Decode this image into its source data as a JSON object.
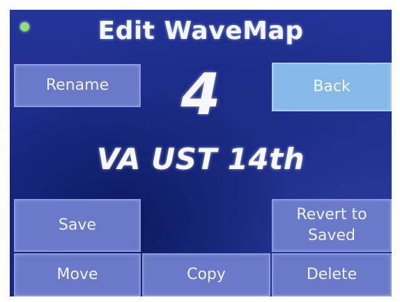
{
  "header": {
    "title": "Edit WaveMap",
    "status_indicator_color": "#8fe07a"
  },
  "wavemap": {
    "number": "4",
    "name": "VA UST 14th"
  },
  "buttons": {
    "rename": "Rename",
    "back": "Back",
    "save": "Save",
    "revert": "Revert to\nSaved",
    "move": "Move",
    "copy": "Copy",
    "delete": "Delete"
  },
  "colors": {
    "screen_background": "#1b2b88",
    "button": "#6a79c8",
    "button_highlight": "#86b8ea",
    "text": "#f2f6ff"
  }
}
